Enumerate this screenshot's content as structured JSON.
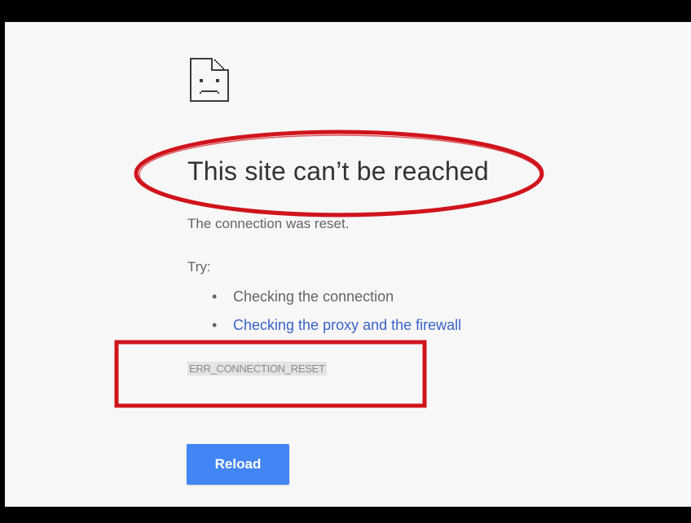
{
  "error_page": {
    "icon": "sad-page-icon",
    "title": "This site can’t be reached",
    "subtitle": "The connection was reset.",
    "try_label": "Try:",
    "suggestions": [
      {
        "text": "Checking the connection",
        "is_link": false
      },
      {
        "text": "Checking the proxy and the firewall",
        "is_link": true
      }
    ],
    "error_code": "ERR_CONNECTION_RESET",
    "reload_label": "Reload"
  },
  "colors": {
    "page_background": "#f7f7f7",
    "title_text": "#333333",
    "body_text": "#646464",
    "link": "#3a63c9",
    "button": "#4285f4",
    "annotation_red": "#d0141c"
  },
  "annotations": [
    {
      "shape": "ellipse",
      "marks": "title"
    },
    {
      "shape": "rectangle",
      "marks": "error_code"
    }
  ]
}
